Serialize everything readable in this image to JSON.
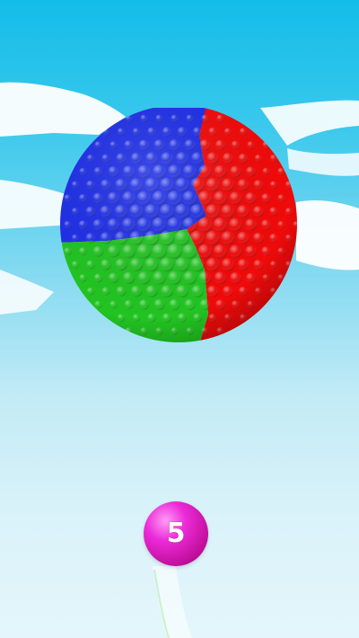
{
  "game": {
    "shooter_ball": {
      "number": "5",
      "color": "#e624d2"
    },
    "target_sphere": {
      "segments": [
        {
          "color": "blue",
          "hex": "#1f2fe6"
        },
        {
          "color": "red",
          "hex": "#f00a0a"
        },
        {
          "color": "green",
          "hex": "#21c421"
        }
      ]
    },
    "sky": {
      "top_color": "#13bde8",
      "bottom_color": "#e4f6fb"
    }
  }
}
